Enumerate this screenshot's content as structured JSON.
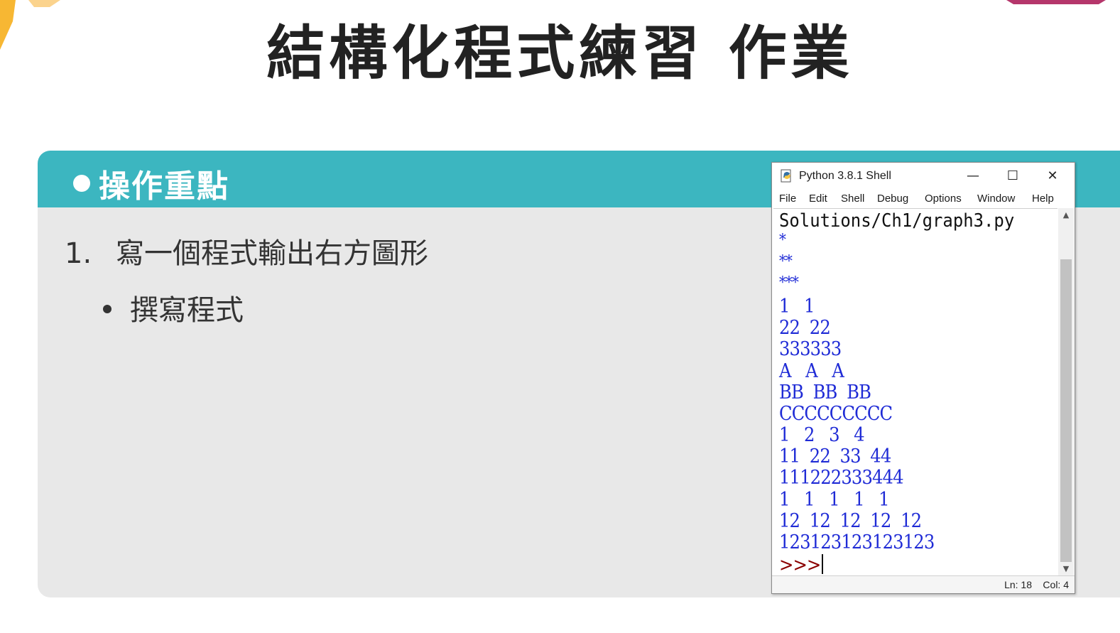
{
  "slide": {
    "title": "結構化程式練習 作業",
    "panel_header": "操作重點",
    "item_number": "1.",
    "item_text": "寫一個程式輸出右方圖形",
    "bullet_text": "撰寫程式"
  },
  "window": {
    "title": "Python 3.8.1 Shell",
    "minimize": "—",
    "maximize": "☐",
    "close": "✕",
    "menu": [
      "File",
      "Edit",
      "Shell",
      "Debug",
      "Options",
      "Window",
      "Help"
    ],
    "shell_lines": [
      "Solutions/Ch1/graph3.py",
      "*",
      "**",
      "***",
      "1   1",
      "22  22",
      "333333",
      "A   A   A",
      "BB  BB  BB",
      "CCCCCCCCC",
      "1   2   3   4",
      "11  22  33  44",
      "111222333444",
      "1   1   1   1   1",
      "12  12  12  12  12",
      "123123123123123"
    ],
    "prompt": ">>>",
    "status_ln": "Ln: 18",
    "status_col": "Col: 4"
  },
  "colors": {
    "header_teal": "#3cb6c0",
    "panel_gray": "#e8e8e8",
    "output_blue": "#1f2bd6",
    "prompt_red": "#8b0000"
  }
}
